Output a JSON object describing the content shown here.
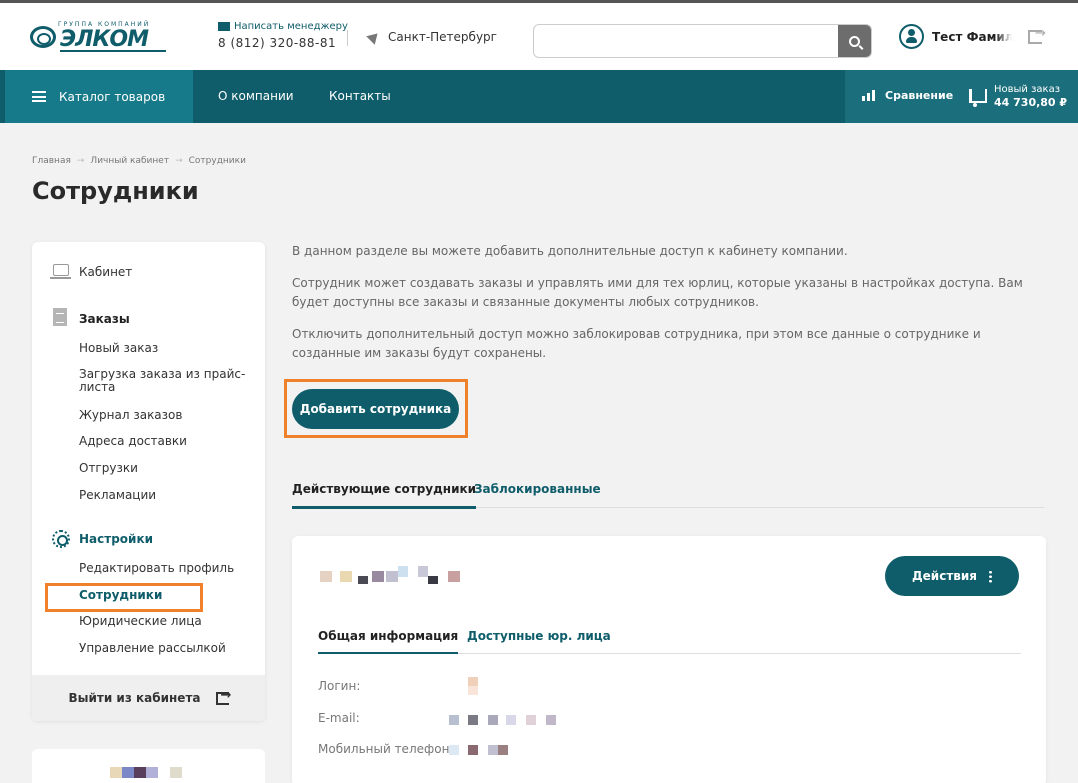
{
  "header": {
    "logo_small": "группа компаний",
    "logo_main": "ЭЛКОМ",
    "manager_link": "Написать менеджеру",
    "phone": "8 (812) 320-88-81",
    "city": "Санкт-Петербург",
    "search_placeholder": "",
    "user_name": "Тест Фамилия"
  },
  "nav": {
    "catalog": "Каталог товаров",
    "about": "О компании",
    "contacts": "Контакты",
    "compare": "Сравнение",
    "cart_label": "Новый заказ",
    "cart_sum": "44 730,80 ₽"
  },
  "breadcrumb": [
    "Главная",
    "Личный кабинет",
    "Сотрудники"
  ],
  "breadcrumb_sep": "→",
  "page_title": "Сотрудники",
  "sidebar": {
    "cabinet": "Кабинет",
    "orders_head": "Заказы",
    "orders": [
      "Новый заказ",
      "Загрузка заказа из прайс-листа",
      "Журнал заказов",
      "Адреса доставки",
      "Отгрузки",
      "Рекламации"
    ],
    "settings_head": "Настройки",
    "settings": [
      "Редактировать профиль",
      "Сотрудники",
      "Юридические лица",
      "Управление рассылкой"
    ],
    "logout": "Выйти из кабинета"
  },
  "main": {
    "intro": "В данном разделе вы можете добавить дополнительные доступ к кабинету компании.",
    "para2": "Сотрудник может создавать заказы и управлять ими для тех юрлиц, которые указаны в настройках доступа. Вам будет доступны все заказы и связанные документы любых сотрудников.",
    "para3": "Отключить дополнительный доступ можно заблокировав сотрудника, при этом все данные о сотруднике и созданные им заказы будут сохранены.",
    "add_button": "Добавить сотрудника",
    "tab_active": "Действующие сотрудники",
    "tab_blocked": "Заблокированные"
  },
  "card": {
    "actions": "Действия",
    "tab_general": "Общая информация",
    "tab_legal": "Доступные юр. лица",
    "login_label": "Логин:",
    "email_label": "E-mail:",
    "phone_label": "Мобильный телефон:"
  },
  "colors": {
    "brand": "#0f5d6a",
    "highlight": "#f0812c"
  }
}
